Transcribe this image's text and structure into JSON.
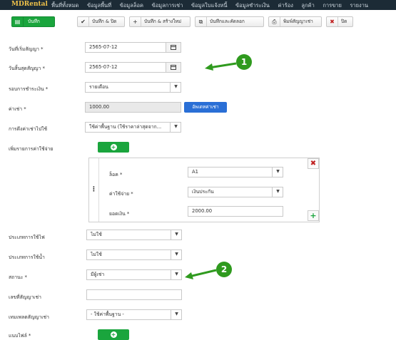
{
  "navbar": {
    "brand": "MDRental",
    "items": [
      "พื้นที่ทั้งหมด",
      "ข้อมูลพื้นที่",
      "ข้อมูลล็อค",
      "ข้อมูลการเช่า",
      "ข้อมูลใบแจ้งหนี้",
      "ข้อมูลชำระเงิน",
      "ค่าร้อง",
      "ลูกค้า",
      "การขาย",
      "รายงาน"
    ]
  },
  "toolbar": {
    "save": "บันทึก",
    "save_close": "บันทึก & ปิด",
    "save_new": "บันทึก & สร้างใหม่",
    "save_copy": "บันทึกและคัดลอก",
    "print": "พิมพ์สัญญาเช่า",
    "close": "ปิด"
  },
  "form": {
    "start_date": {
      "label": "วันที่เริ่มสัญญา *",
      "value": "2565-07-12"
    },
    "end_date": {
      "label": "วันสิ้นสุดสัญญา *",
      "value": "2565-07-12"
    },
    "payment_cycle": {
      "label": "รอบการชำระเงิน *",
      "value": "รายเดือน"
    },
    "rent": {
      "label": "ค่าเช่า *",
      "value": "1000.00",
      "button": "อัพเดทค่าเช่า"
    },
    "rent_source": {
      "label": "การดึงค่าเช่าไปใช้",
      "value": "ใช้ค่าพื้นฐาน (ใช้ราคาล่าสุดจาก..."
    },
    "add_expense": {
      "label": "เพิ่มรายการค่าใช้จ่าย"
    },
    "expense_row": {
      "lock_label": "ล็อค *",
      "lock_value": "A1",
      "expense_label": "ค่าใช้จ่าย *",
      "expense_value": "เงินประกัน",
      "amount_label": "ยอดเงิน *",
      "amount_value": "2000.00"
    },
    "electric_type": {
      "label": "ประเภทการใช้ไฟ",
      "value": "ไม่ใช้"
    },
    "water_type": {
      "label": "ประเภทการใช้น้ำ",
      "value": "ไม่ใช้"
    },
    "status": {
      "label": "สถานะ *",
      "value": "มีผู้เช่า"
    },
    "contract_no": {
      "label": "เลขที่สัญญาเช่า",
      "value": ""
    },
    "contract_template": {
      "label": "เทมเพลตสัญญาเช่า",
      "value": "- ใช้ค่าพื้นฐาน -"
    },
    "bottom_partial": {
      "label": "แนบไฟล์ *"
    }
  },
  "annotations": {
    "callout_1": "1",
    "callout_2": "2",
    "arrow_color": "#2f9a1e"
  },
  "colors": {
    "navbar": "#1c2b36",
    "brand": "#f0c24a",
    "primary_green": "#1aa53d",
    "blue_button": "#2a6fd6",
    "delete_red": "#c02020"
  }
}
